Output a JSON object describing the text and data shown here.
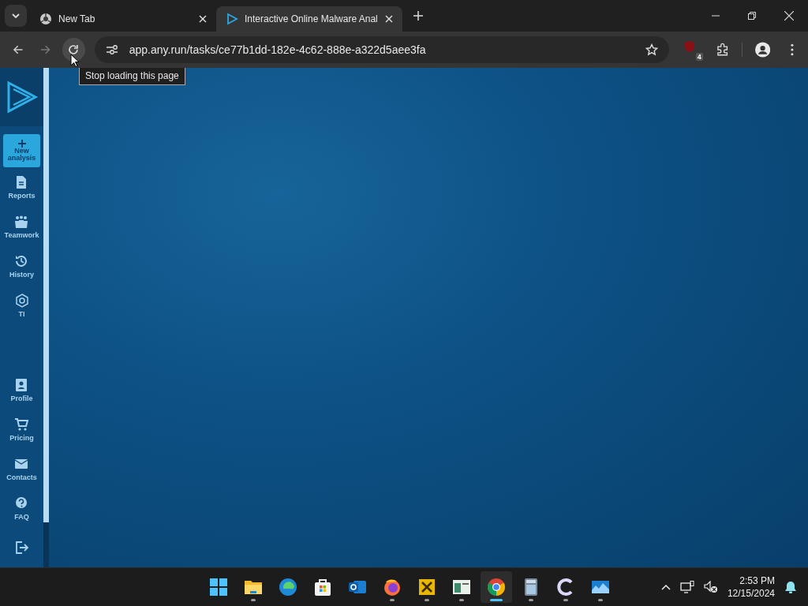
{
  "tabs": [
    {
      "title": "New Tab",
      "kind": "chrome",
      "selected": false
    },
    {
      "title": "Interactive Online Malware Anal",
      "kind": "anyrun",
      "selected": true
    }
  ],
  "address": {
    "url": "app.any.run/tasks/ce77b1dd-182e-4c62-888e-a322d5aee3fa"
  },
  "tooltip": "Stop loading this page",
  "extension_badge": "4",
  "sidebar": {
    "new_button": "New analysis",
    "items": [
      {
        "label": "Reports",
        "kind": "doc"
      },
      {
        "label": "Teamwork",
        "kind": "team"
      },
      {
        "label": "History",
        "kind": "history"
      },
      {
        "label": "TI",
        "kind": "hex"
      }
    ],
    "bottom_items": [
      {
        "label": "Profile",
        "kind": "profile"
      },
      {
        "label": "Pricing",
        "kind": "cart"
      },
      {
        "label": "Contacts",
        "kind": "mail"
      },
      {
        "label": "FAQ",
        "kind": "help"
      },
      {
        "kind": "exit"
      }
    ]
  },
  "taskbar": {
    "apps": [
      {
        "kind": "start",
        "running": false,
        "selected": false
      },
      {
        "kind": "files",
        "running": true,
        "selected": false
      },
      {
        "kind": "edge",
        "running": false,
        "selected": false
      },
      {
        "kind": "store",
        "running": false,
        "selected": false
      },
      {
        "kind": "outlook",
        "running": false,
        "selected": false
      },
      {
        "kind": "firefox",
        "running": true,
        "selected": false
      },
      {
        "kind": "yellow",
        "running": true,
        "selected": false
      },
      {
        "kind": "window",
        "running": true,
        "selected": false
      },
      {
        "kind": "chrome",
        "running": true,
        "selected": true
      },
      {
        "kind": "calculator",
        "running": true,
        "selected": false
      },
      {
        "kind": "c-app",
        "running": true,
        "selected": false
      },
      {
        "kind": "monitor",
        "running": true,
        "selected": false
      }
    ],
    "time": "2:53 PM",
    "date": "12/15/2024"
  }
}
